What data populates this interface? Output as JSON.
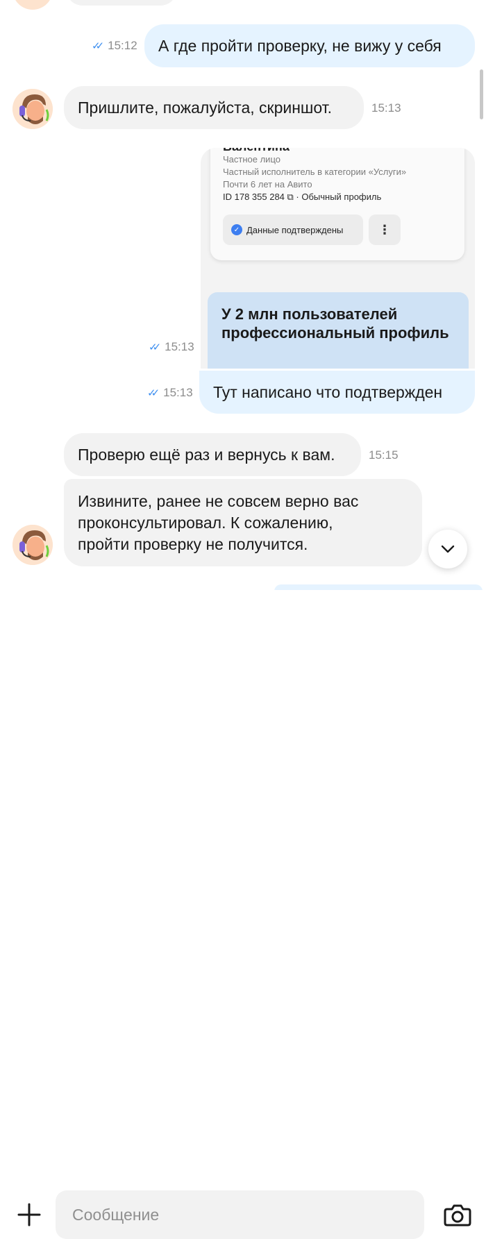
{
  "messages": [
    {
      "text": "А где пройти проверку, не вижу у себя",
      "time": "15:12"
    },
    {
      "text": "Пришлите, пожалуйста, скриншот.",
      "time": "15:13"
    },
    {
      "time": "15:13"
    },
    {
      "text": "Тут написано что подтвержден",
      "time": "15:13"
    },
    {
      "text": "Проверю ещё раз и вернусь к вам.",
      "time": "15:15"
    },
    {
      "lines": [
        "Извините, ранее не совсем верно вас",
        "проконсультировал. К сожалению,",
        "пройти проверку не получится."
      ]
    }
  ],
  "screenshot": {
    "name_cut": "Валентина",
    "lines": [
      "Частное лицо",
      "Частный исполнитель в категории «Услуги»",
      "Почти 6 лет на Авито"
    ],
    "id_line": "ID 178 355 284 ⧉ · Обычный профиль",
    "verified_label": "Данные подтверждены",
    "promo": "У 2 млн пользователей профессиональный профиль"
  },
  "composer": {
    "placeholder": "Сообщение"
  },
  "colors": {
    "incoming": "#f2f2f2",
    "outgoing": "#e5f3ff",
    "read_ticks": "#3d8ff0"
  },
  "icons": [
    "read-ticks-icon",
    "support-avatar",
    "scroll-down-icon",
    "plus-icon",
    "camera-icon"
  ]
}
